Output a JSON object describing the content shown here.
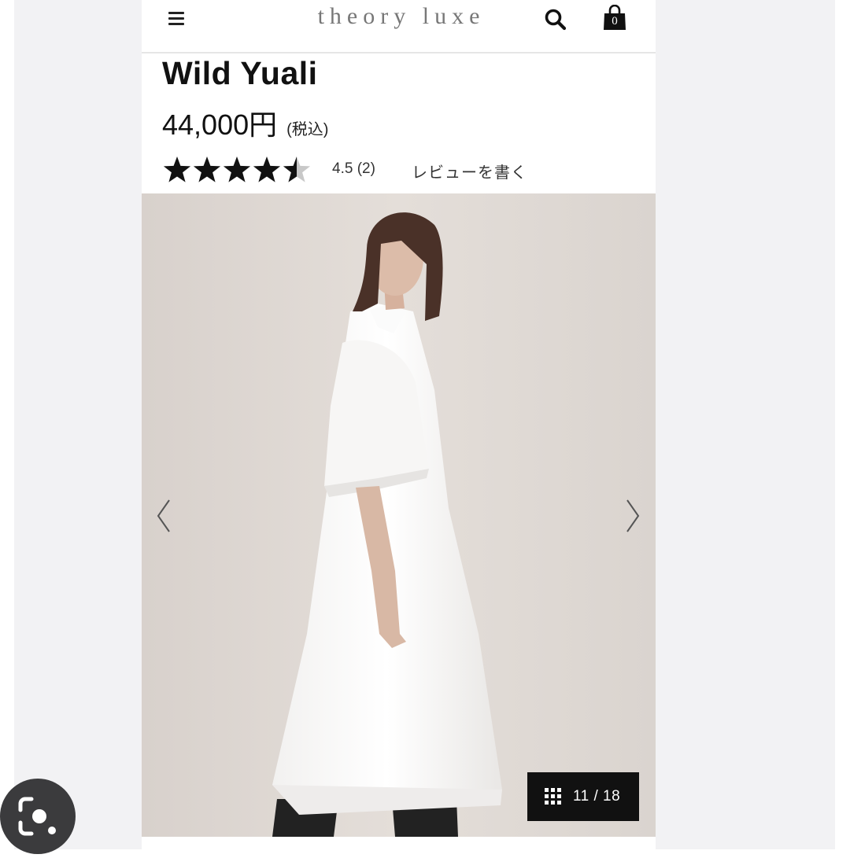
{
  "header": {
    "menu_icon": "hamburger-menu-icon",
    "logo": "theory luxe",
    "search_icon": "search-icon",
    "cart_icon": "shopping-bag-icon",
    "cart_count": "0"
  },
  "product": {
    "name": "Wild Yuali",
    "price": "44,000",
    "currency": "円",
    "tax_note": "(税込)",
    "rating_stars": 4.5,
    "rating_text": "4.5 (2)",
    "review_link": "レビューを書く"
  },
  "gallery": {
    "prev_icon": "chevron-left-icon",
    "next_icon": "chevron-right-icon",
    "grid_icon": "grid-icon",
    "counter": "11 / 18"
  },
  "overlay": {
    "lens_icon": "lens-search-icon"
  },
  "colors": {
    "background": "#f2f2f4",
    "text": "#111111",
    "photo_backdrop": "#e3ddd8",
    "counter_badge": "#111111"
  }
}
